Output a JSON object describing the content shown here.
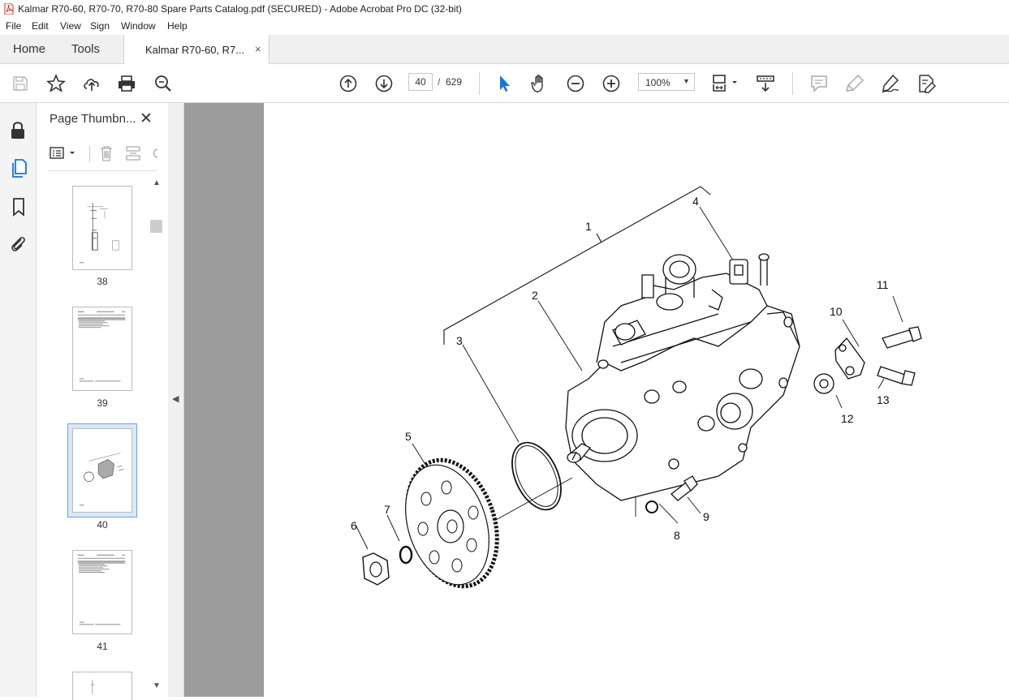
{
  "window": {
    "title": "Kalmar R70-60, R70-70, R70-80 Spare Parts Catalog.pdf (SECURED) - Adobe Acrobat Pro DC (32-bit)"
  },
  "menu": [
    "File",
    "Edit",
    "View",
    "Sign",
    "Window",
    "Help"
  ],
  "tabs": {
    "home": "Home",
    "tools": "Tools",
    "document": "Kalmar R70-60, R7...",
    "close": "×"
  },
  "toolbar": {
    "current_page": "40",
    "page_sep": "/",
    "total_pages": "629",
    "zoom": "100%",
    "icons": [
      "save-icon",
      "bookmark-star-icon",
      "upload-icon",
      "print-icon",
      "search-zoom-icon",
      "page-up-icon",
      "page-down-icon",
      "select-arrow-icon",
      "hand-icon",
      "zoom-out-icon",
      "zoom-in-icon",
      "fit-page-icon",
      "scroll-mode-icon",
      "comment-icon",
      "highlight-icon",
      "sign-icon",
      "edit-pdf-icon"
    ]
  },
  "thumbnails_panel": {
    "title": "Page Thumbn...",
    "close": "✕",
    "pages": [
      {
        "number": "38",
        "selected": false
      },
      {
        "number": "39",
        "selected": false
      },
      {
        "number": "40",
        "selected": true
      },
      {
        "number": "41",
        "selected": false
      }
    ]
  },
  "diagram": {
    "callouts": [
      "1",
      "2",
      "3",
      "4",
      "5",
      "6",
      "7",
      "8",
      "9",
      "10",
      "11",
      "12",
      "13"
    ]
  },
  "colors": {
    "accent": "#1473e6",
    "doc_background": "#9c9c9c",
    "pdf_icon_red": "#e1251b"
  }
}
